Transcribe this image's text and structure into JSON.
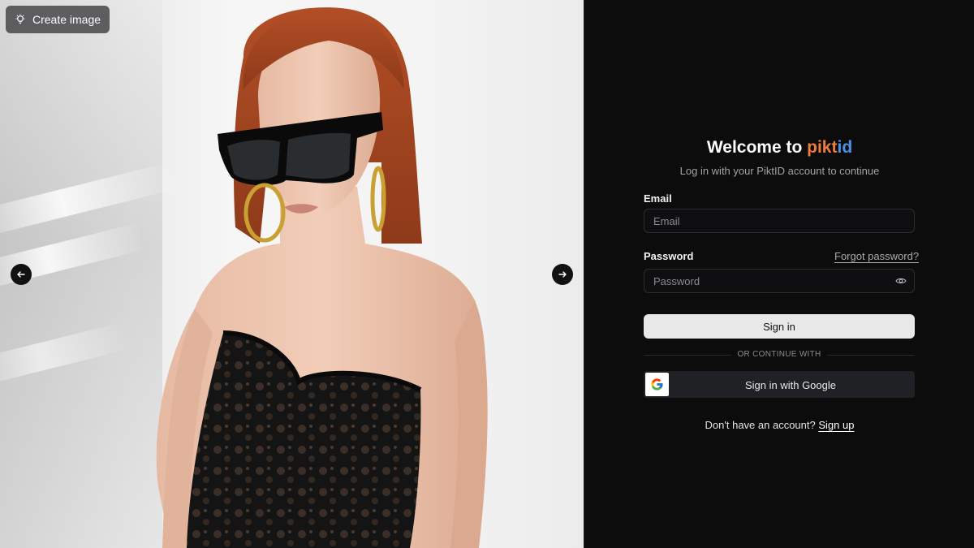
{
  "hero": {
    "create_button_label": "Create image",
    "create_icon": "lightbulb-icon",
    "prev_icon": "arrow-left-icon",
    "next_icon": "arrow-right-icon"
  },
  "auth": {
    "welcome_prefix": "Welcome to ",
    "brand_part1": "pikt",
    "brand_part2": "id",
    "subtitle": "Log in with your PiktID account to continue",
    "email_label": "Email",
    "email_placeholder": "Email",
    "password_label": "Password",
    "password_placeholder": "Password",
    "forgot_password": "Forgot password?",
    "show_password_icon": "eye-icon",
    "signin_button": "Sign in",
    "divider_text": "OR CONTINUE WITH",
    "google_button": "Sign in with Google",
    "google_icon": "google-logo-icon",
    "no_account_text": "Don't have an account? ",
    "signup_link": "Sign up"
  },
  "colors": {
    "brand_orange": "#f07b3a",
    "brand_blue": "#4c93e6",
    "panel_bg": "#0c0c0d",
    "signin_bg": "#e8e8e9",
    "google_bg": "#202124"
  }
}
